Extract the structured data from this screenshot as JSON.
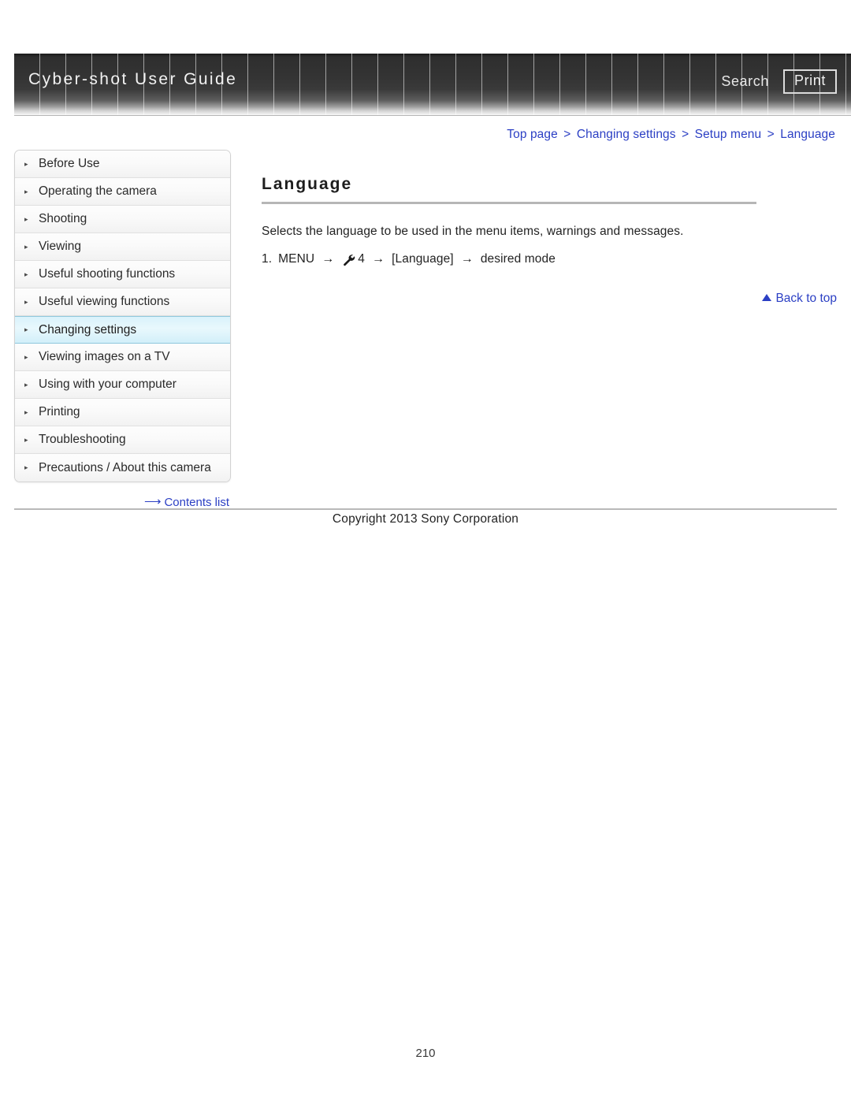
{
  "header": {
    "title": "Cyber-shot User Guide",
    "search_label": "Search",
    "print_label": "Print"
  },
  "breadcrumb": {
    "separator": ">",
    "items": [
      {
        "label": "Top page"
      },
      {
        "label": "Changing settings"
      },
      {
        "label": "Setup menu"
      },
      {
        "label": "Language"
      }
    ]
  },
  "sidebar": {
    "items": [
      {
        "label": "Before Use",
        "bullet": "▸",
        "active": false
      },
      {
        "label": "Operating the camera",
        "bullet": "▸",
        "active": false
      },
      {
        "label": "Shooting",
        "bullet": "▸",
        "active": false
      },
      {
        "label": "Viewing",
        "bullet": "▸",
        "active": false
      },
      {
        "label": "Useful shooting functions",
        "bullet": "▸",
        "active": false
      },
      {
        "label": "Useful viewing functions",
        "bullet": "▸",
        "active": false
      },
      {
        "label": "Changing settings",
        "bullet": "▸",
        "active": true
      },
      {
        "label": "Viewing images on a TV",
        "bullet": "▸",
        "active": false
      },
      {
        "label": "Using with your computer",
        "bullet": "▸",
        "active": false
      },
      {
        "label": "Printing",
        "bullet": "▸",
        "active": false
      },
      {
        "label": "Troubleshooting",
        "bullet": "▸",
        "active": false
      },
      {
        "label": "Precautions / About this camera",
        "bullet": "▸",
        "active": false
      }
    ],
    "contents_list_label": "Contents list",
    "contents_list_arrow": "⟶"
  },
  "main": {
    "title": "Language",
    "description": "Selects the language to be used in the menu items, warnings and messages.",
    "step": {
      "number": "1.",
      "menu_label": "MENU",
      "arrow": "→",
      "wrench_icon_name": "wrench-icon",
      "menu_number": "4",
      "bracket_item": "[Language]",
      "result": "desired mode"
    },
    "back_to_top_label": "Back to top"
  },
  "footer": {
    "copyright": "Copyright 2013 Sony Corporation",
    "page_number": "210"
  },
  "colors": {
    "link_blue": "#2b3fc4",
    "active_nav": "#d9f2fb",
    "header_dark": "#343434",
    "rule_gray": "#b6b6b6"
  }
}
